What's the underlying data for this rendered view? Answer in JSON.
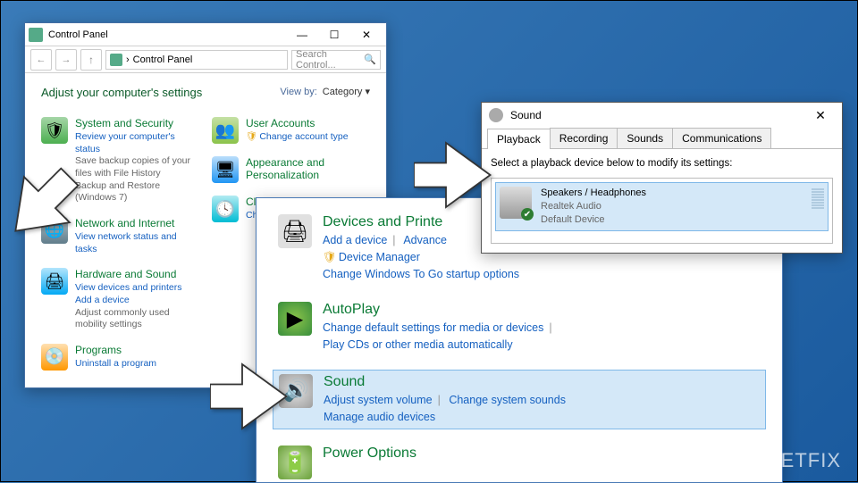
{
  "cp": {
    "title": "Control Panel",
    "back_tip": "←",
    "fwd_tip": "→",
    "up_tip": "↑",
    "address": "Control Panel",
    "search_ph": "Search Control...",
    "heading": "Adjust your computer's settings",
    "viewby_label": "View by:",
    "viewby_value": "Category ▾",
    "left_items": [
      {
        "cat": "System and Security",
        "subs": [
          "Review your computer's status",
          "Save backup copies of your files with File History",
          "Backup and Restore (Windows 7)"
        ]
      },
      {
        "cat": "Network and Internet",
        "subs": [
          "View network status and tasks"
        ]
      },
      {
        "cat": "Hardware and Sound",
        "subs": [
          "View devices and printers",
          "Add a device",
          "Adjust commonly used mobility settings"
        ]
      },
      {
        "cat": "Programs",
        "subs": [
          "Uninstall a program"
        ]
      }
    ],
    "right_items": [
      {
        "cat": "User Accounts",
        "subs": [
          "Change account type"
        ],
        "shield": true
      },
      {
        "cat": "Appearance and Personalization",
        "subs": []
      },
      {
        "cat": "Clock and Region",
        "subs": [
          "Change date, time, or"
        ]
      }
    ]
  },
  "mid": {
    "items": [
      {
        "cat": "Devices and Printe",
        "links": [
          "Add a device",
          "Advance",
          "Device Manager",
          "Change Windows To Go startup options"
        ],
        "shield_at": 2
      },
      {
        "cat": "AutoPlay",
        "links": [
          "Change default settings for media or devices",
          "Play CDs or other media automatically"
        ]
      },
      {
        "cat": "Sound",
        "links": [
          "Adjust system volume",
          "Change system sounds",
          "Manage audio devices"
        ],
        "highlight": true
      },
      {
        "cat": "Power Options",
        "links": []
      }
    ]
  },
  "snd": {
    "title": "Sound",
    "tabs": [
      "Playback",
      "Recording",
      "Sounds",
      "Communications"
    ],
    "instruction": "Select a playback device below to modify its settings:",
    "device": {
      "name": "Speakers / Headphones",
      "driver": "Realtek Audio",
      "status": "Default Device"
    }
  },
  "watermark": "UGETFIX"
}
